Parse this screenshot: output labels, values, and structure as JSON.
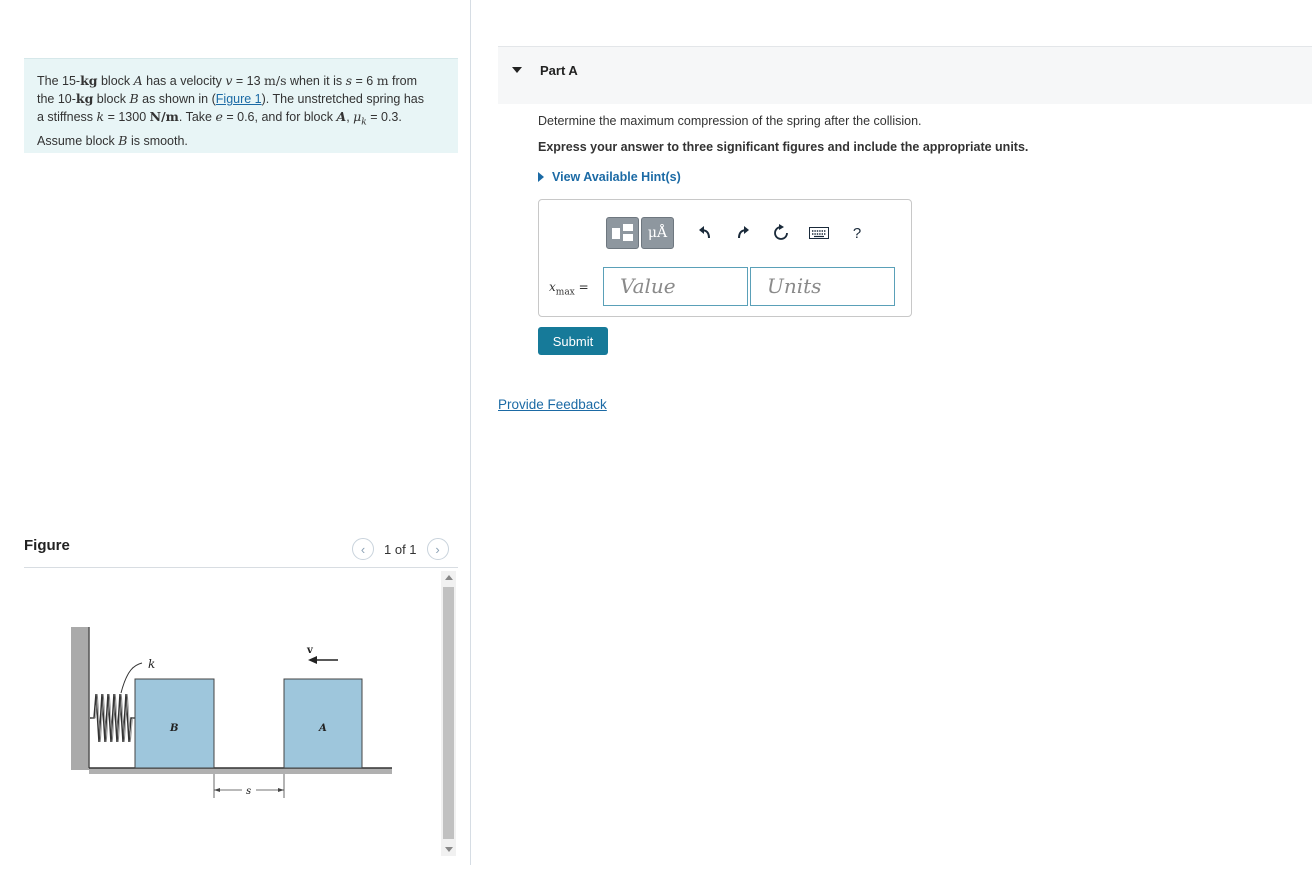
{
  "problem": {
    "l1_a": "The 15-",
    "l1_kg": "kg",
    "l1_b": " block ",
    "l1_A": "A",
    "l1_c": " has a velocity ",
    "l1_v": "v",
    "l1_d": " = 13 ",
    "l1_ms": "m/s",
    "l1_e": " when it is ",
    "l1_s": "s",
    "l1_f": " = 6 ",
    "l1_m": "m",
    "l1_g": " from",
    "l2_a": "the 10-",
    "l2_kg": "kg",
    "l2_b": " block ",
    "l2_B": "B",
    "l2_c": " as shown in (",
    "l2_link": "Figure 1",
    "l2_d": "). The unstretched spring has",
    "l3_a": "a stiffness ",
    "l3_k": "k",
    "l3_b": " = 1300 ",
    "l3_Nm": "N/m",
    "l3_c": ". Take ",
    "l3_e": "e",
    "l3_d": " = 0.6, and for block ",
    "l3_A": "A",
    "l3_f": ", ",
    "l3_mu": "μ",
    "l3_muk": "k",
    "l3_g": " = 0.3.",
    "l4_a": "Assume block ",
    "l4_B": "B",
    "l4_b": " is smooth."
  },
  "figure": {
    "title": "Figure",
    "counter": "1 of 1",
    "prev_glyph": "‹",
    "next_glyph": "›",
    "labels": {
      "k": "k",
      "v": "v",
      "B": "B",
      "A": "A",
      "s": "s"
    }
  },
  "part": {
    "title": "Part A",
    "question": "Determine the maximum compression of the spring after the collision.",
    "instruction": "Express your answer to three significant figures and include the appropriate units.",
    "hint": "View Available Hint(s)",
    "var_x": "x",
    "var_sub": "max",
    "var_eq": " =",
    "value_placeholder": "Value",
    "units_placeholder": "Units",
    "toolbar": {
      "mu_label": "μÅ",
      "help": "?"
    },
    "submit": "Submit",
    "feedback": "Provide Feedback"
  }
}
